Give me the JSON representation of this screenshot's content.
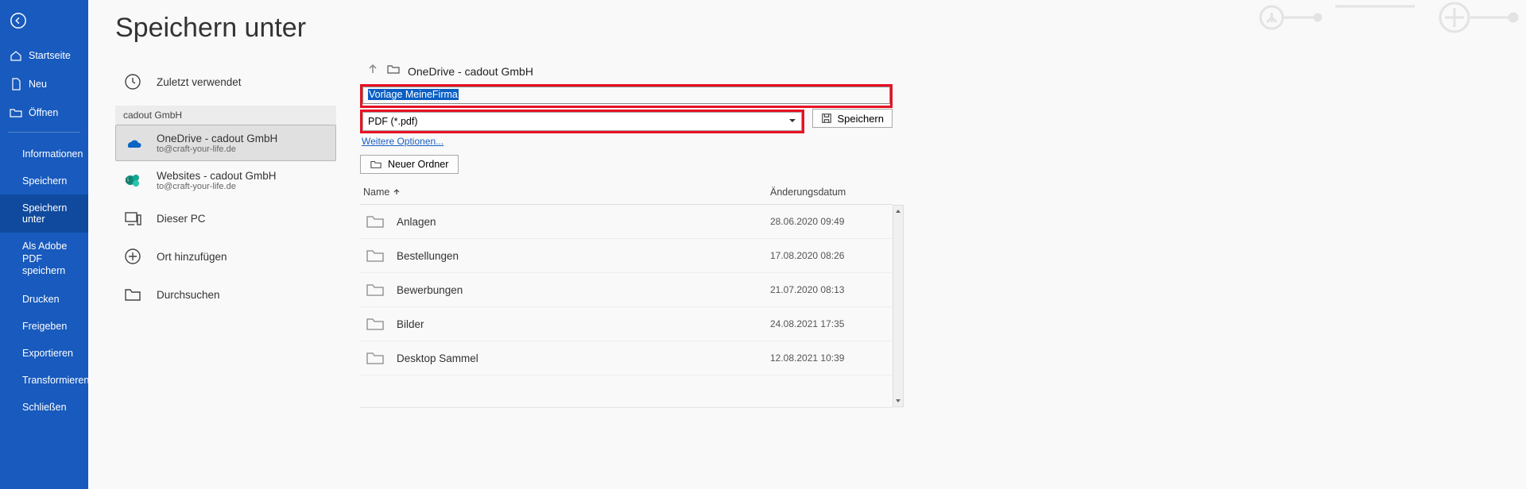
{
  "colors": {
    "accent": "#185abd",
    "highlight": "#e81123",
    "link": "#1a5fc4"
  },
  "sidebar": {
    "items": [
      {
        "icon": "home",
        "label": "Startseite"
      },
      {
        "icon": "doc",
        "label": "Neu"
      },
      {
        "icon": "open",
        "label": "Öffnen"
      }
    ],
    "subitems": [
      {
        "label": "Informationen",
        "active": false
      },
      {
        "label": "Speichern",
        "active": false
      },
      {
        "label": "Speichern unter",
        "active": true
      },
      {
        "label": "Als Adobe PDF speichern",
        "active": false
      },
      {
        "label": "Drucken",
        "active": false
      },
      {
        "label": "Freigeben",
        "active": false
      },
      {
        "label": "Exportieren",
        "active": false
      },
      {
        "label": "Transformieren",
        "active": false
      },
      {
        "label": "Schließen",
        "active": false
      }
    ]
  },
  "page": {
    "title": "Speichern unter"
  },
  "locations": {
    "recent_label": "Zuletzt verwendet",
    "org_header": "cadout GmbH",
    "onedrive_label": "OneDrive - cadout GmbH",
    "onedrive_sub": "to@craft-your-life.de",
    "sites_label": "Websites - cadout GmbH",
    "sites_sub": "to@craft-your-life.de",
    "thispc_label": "Dieser PC",
    "addplace_label": "Ort hinzufügen",
    "browse_label": "Durchsuchen"
  },
  "save_area": {
    "breadcrumb": "OneDrive - cadout GmbH",
    "filename": "Vorlage MeineFirma",
    "filetype": "PDF (*.pdf)",
    "save_label": "Speichern",
    "more_options": "Weitere Optionen...",
    "new_folder": "Neuer Ordner",
    "col_name": "Name",
    "col_date": "Änderungsdatum",
    "rows": [
      {
        "name": "Anlagen",
        "date": "28.06.2020 09:49"
      },
      {
        "name": "Bestellungen",
        "date": "17.08.2020 08:26"
      },
      {
        "name": "Bewerbungen",
        "date": "21.07.2020 08:13"
      },
      {
        "name": "Bilder",
        "date": "24.08.2021 17:35"
      },
      {
        "name": "Desktop Sammel",
        "date": "12.08.2021 10:39"
      }
    ]
  }
}
